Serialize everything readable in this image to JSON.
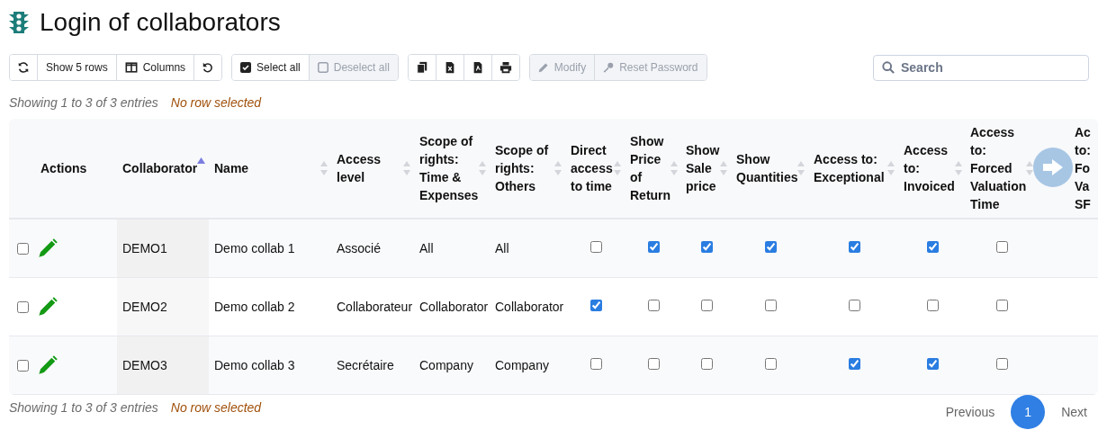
{
  "title": "Login of collaborators",
  "toolbar": [
    {
      "buttons": [
        {
          "kind": "refresh",
          "disabled": false
        },
        {
          "kind": "rows",
          "label": "Show 5 rows",
          "disabled": false
        },
        {
          "kind": "columns",
          "label": "Columns",
          "disabled": false
        },
        {
          "kind": "reset",
          "disabled": false
        }
      ]
    },
    {
      "buttons": [
        {
          "kind": "selectall",
          "label": "Select all",
          "disabled": false
        },
        {
          "kind": "deselectall",
          "label": "Deselect all",
          "disabled": true
        }
      ]
    },
    {
      "buttons": [
        {
          "kind": "copy",
          "disabled": false
        },
        {
          "kind": "excel",
          "disabled": false
        },
        {
          "kind": "pdf",
          "disabled": false
        },
        {
          "kind": "print",
          "disabled": false
        }
      ]
    },
    {
      "buttons": [
        {
          "kind": "modify",
          "label": "Modify",
          "disabled": true
        },
        {
          "kind": "password",
          "label": "Reset Password",
          "disabled": true
        }
      ]
    }
  ],
  "search": {
    "placeholder": "Search"
  },
  "info_top": {
    "entries": "Showing 1 to 3 of 3 entries",
    "selection": "No row selected"
  },
  "info_bottom": {
    "entries": "Showing 1 to 3 of 3 entries",
    "selection": "No row selected"
  },
  "table": {
    "columns": [
      {
        "label": "Actions",
        "kind": "actions",
        "sortable": false
      },
      {
        "label": "Collaborator",
        "kind": "code",
        "sortable": true,
        "sorted_ascending": true
      },
      {
        "label": "Name",
        "kind": "text",
        "sortable": true,
        "sorted_ascending": false
      },
      {
        "label": "Access level",
        "kind": "text",
        "sortable": true,
        "sorted_ascending": false
      },
      {
        "label": "Scope of rights: Time & Expenses",
        "kind": "text",
        "sortable": true,
        "sorted_ascending": false
      },
      {
        "label": "Scope of rights: Others",
        "kind": "text",
        "sortable": true,
        "sorted_ascending": false
      },
      {
        "label": "Direct access to time",
        "kind": "bool",
        "sortable": true,
        "sorted_ascending": false
      },
      {
        "label": "Show Price of Return",
        "kind": "bool",
        "sortable": true,
        "sorted_ascending": false
      },
      {
        "label": "Show Sale price",
        "kind": "bool",
        "sortable": true,
        "sorted_ascending": false
      },
      {
        "label": "Show Quantities",
        "kind": "bool",
        "sortable": true,
        "sorted_ascending": false
      },
      {
        "label": "Access to: Exceptional",
        "kind": "bool",
        "sortable": true,
        "sorted_ascending": false
      },
      {
        "label": "Access to: Invoiced",
        "kind": "bool",
        "sortable": true,
        "sorted_ascending": false
      },
      {
        "label": "Access to: Forced Valuation Time",
        "kind": "bool",
        "sortable": true,
        "sorted_ascending": false
      },
      {
        "label": "Ac to: Fo Va SF",
        "kind": "cut"
      }
    ],
    "rows": [
      {
        "selected": false,
        "cells": [
          null,
          "DEMO1",
          "Demo collab 1",
          "Associé",
          "All",
          "All",
          false,
          true,
          true,
          true,
          true,
          true,
          false
        ]
      },
      {
        "selected": false,
        "cells": [
          null,
          "DEMO2",
          "Demo collab 2",
          "Collaborateur",
          "Collaborator",
          "Collaborator",
          true,
          false,
          false,
          false,
          false,
          false,
          false
        ]
      },
      {
        "selected": false,
        "cells": [
          null,
          "DEMO3",
          "Demo collab 3",
          "Secrétaire",
          "Company",
          "Company",
          false,
          false,
          false,
          false,
          true,
          true,
          false
        ]
      }
    ]
  },
  "pagination": {
    "previous": "Previous",
    "pages": [
      {
        "label": "1",
        "selected": true
      }
    ],
    "next": "Next"
  }
}
